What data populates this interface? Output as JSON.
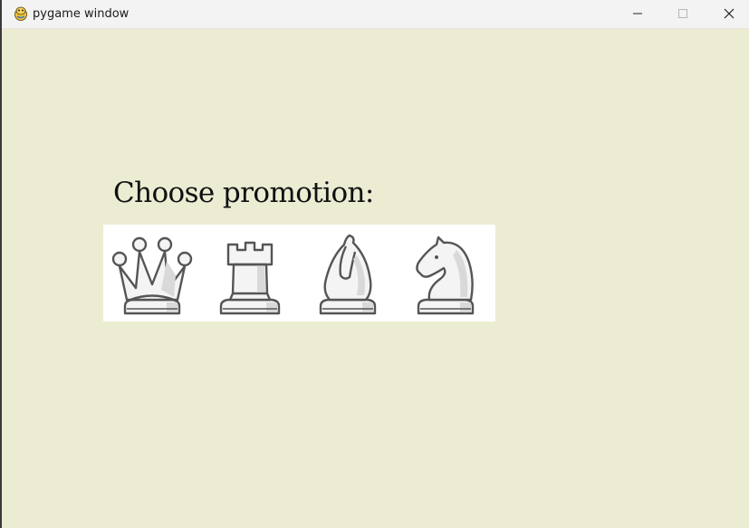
{
  "window": {
    "title": "pygame window",
    "app_icon": "pygame-snake-icon",
    "controls": [
      "minimize-icon",
      "maximize-icon",
      "close-icon"
    ]
  },
  "colors": {
    "background": "#ececd3",
    "panel": "#ffffff",
    "piece_fill": "#f4f4f4",
    "piece_shade": "#d9d9d9",
    "piece_outline": "#555555"
  },
  "promotion": {
    "prompt": "Choose promotion:",
    "options": [
      {
        "piece": "queen",
        "icon": "white-queen-icon"
      },
      {
        "piece": "rook",
        "icon": "white-rook-icon"
      },
      {
        "piece": "bishop",
        "icon": "white-bishop-icon"
      },
      {
        "piece": "knight",
        "icon": "white-knight-icon"
      }
    ]
  }
}
